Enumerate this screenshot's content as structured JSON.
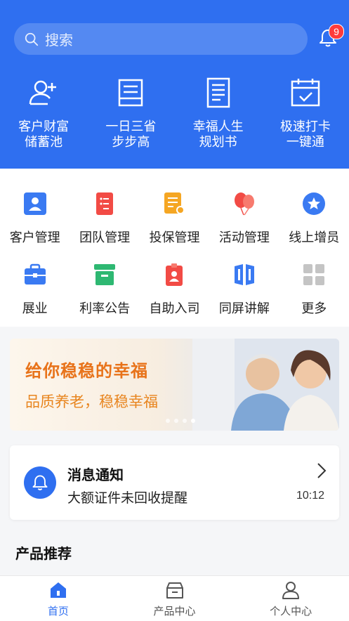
{
  "search": {
    "placeholder": "搜索"
  },
  "notifications": {
    "badge_count": "9"
  },
  "quick_links": [
    {
      "line1": "客户财富",
      "line2": "储蓄池",
      "icon": "add-user-icon"
    },
    {
      "line1": "一日三省",
      "line2": "步步高",
      "icon": "inbox-tray-icon"
    },
    {
      "line1": "幸福人生",
      "line2": "规划书",
      "icon": "document-icon"
    },
    {
      "line1": "极速打卡",
      "line2": "一键通",
      "icon": "calendar-check-icon"
    }
  ],
  "menu": [
    {
      "label": "客户管理",
      "icon": "customer-icon",
      "color": "#3a7af2"
    },
    {
      "label": "团队管理",
      "icon": "team-doc-icon",
      "color": "#f24b45"
    },
    {
      "label": "投保管理",
      "icon": "policy-icon",
      "color": "#f5a623"
    },
    {
      "label": "活动管理",
      "icon": "balloon-icon",
      "color": "#f24b45"
    },
    {
      "label": "线上增员",
      "icon": "star-badge-icon",
      "color": "#3a7af2"
    },
    {
      "label": "展业",
      "icon": "briefcase-icon",
      "color": "#3a7af2"
    },
    {
      "label": "利率公告",
      "icon": "archive-box-icon",
      "color": "#2eb872"
    },
    {
      "label": "自助入司",
      "icon": "id-badge-icon",
      "color": "#f24b45"
    },
    {
      "label": "同屏讲解",
      "icon": "screen-share-icon",
      "color": "#3a7af2"
    },
    {
      "label": "更多",
      "icon": "more-grid-icon",
      "color": "#c4c4c4"
    }
  ],
  "banner": {
    "title": "给你稳稳的幸福",
    "subtitle": "品质养老，稳稳幸福",
    "slides": 4,
    "active_slide": 4
  },
  "message": {
    "title": "消息通知",
    "body": "大额证件未回收提醒",
    "time": "10:12"
  },
  "products": {
    "section_title": "产品推荐"
  },
  "tabbar": [
    {
      "label": "首页",
      "active": true
    },
    {
      "label": "产品中心",
      "active": false
    },
    {
      "label": "个人中心",
      "active": false
    }
  ],
  "colors": {
    "primary": "#2f6ff0",
    "badge": "#ff3b3b",
    "banner_text": "#e8731a"
  }
}
